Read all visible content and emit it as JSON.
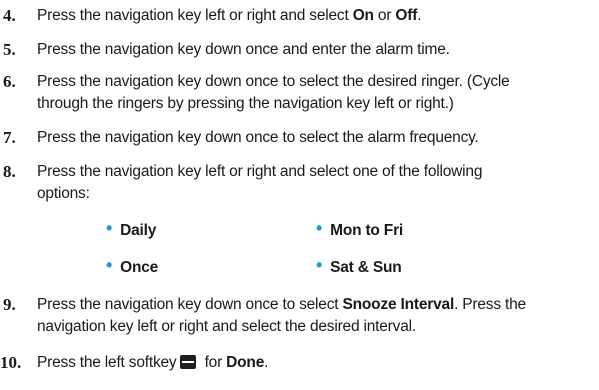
{
  "steps": [
    {
      "num": "4.",
      "parts": [
        "Press the navigation key left or right and select ",
        "On",
        " or ",
        "Off",
        "."
      ]
    },
    {
      "num": "5.",
      "text": "Press the navigation key down once and enter the alarm time."
    },
    {
      "num": "6.",
      "line1": "Press the navigation key down once to select the desired ringer. (Cycle",
      "line2": "through the ringers by pressing the navigation key left or right.)"
    },
    {
      "num": "7.",
      "text": "Press the navigation key down once to select the alarm frequency."
    },
    {
      "num": "8.",
      "line1": "Press the navigation key left or right and select one of the following",
      "line2": "options:"
    },
    {
      "num": "9.",
      "line1_a": "Press the navigation key down once to select ",
      "line1_b": "Snooze Interval",
      "line1_c": ". Press the",
      "line2": "navigation key left or right and select the desired interval."
    },
    {
      "num": "10.",
      "a": "Press the left softkey",
      "b": " for ",
      "c": "Done",
      "d": "."
    }
  ],
  "options": [
    "Daily",
    "Mon to Fri",
    "Once",
    "Sat & Sun"
  ],
  "bullet": "•",
  "icons": {
    "softkey": "left-softkey-icon"
  },
  "colors": {
    "bullet": "#1e9bd7",
    "text": "#1a1a1a"
  }
}
